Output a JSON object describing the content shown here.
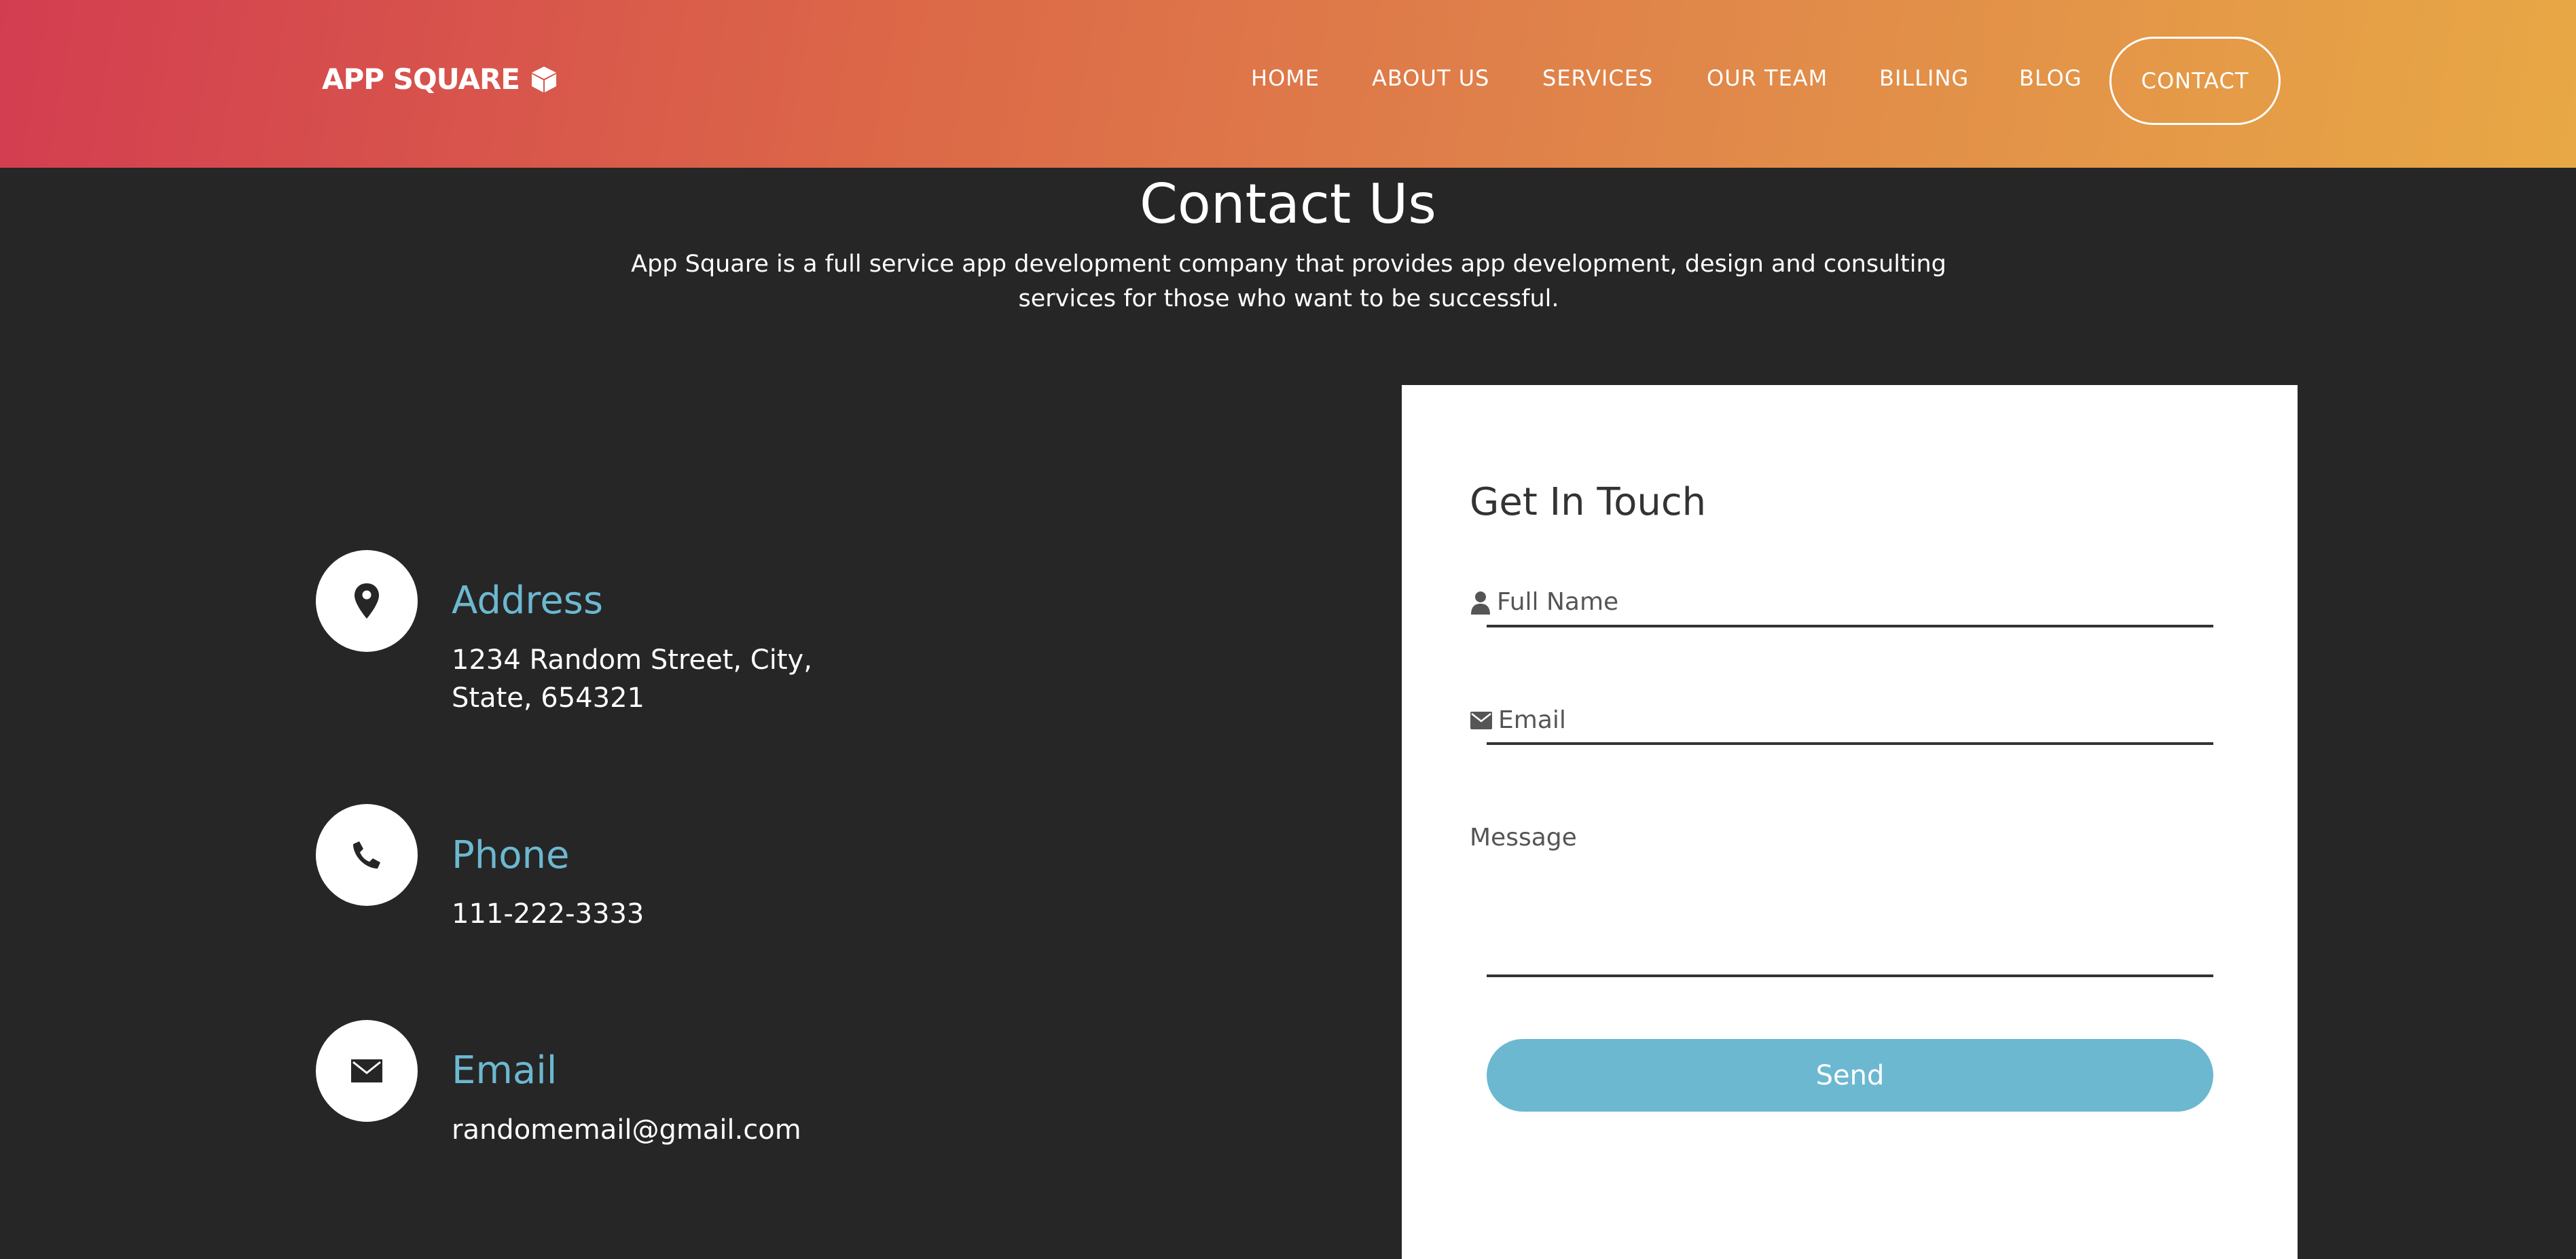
{
  "header": {
    "brand": "APP SQUARE",
    "brand_icon": "cube-icon",
    "nav": {
      "home": "HOME",
      "about": "ABOUT US",
      "services": "SERVICES",
      "team": "OUR TEAM",
      "billing": "BILLING",
      "blog": "BLOG",
      "contact": "CONTACT"
    },
    "gradient_colors": [
      "#d33d50",
      "#e8a845"
    ]
  },
  "page": {
    "title": "Contact Us",
    "description": "App Square is a full service app development company that provides app development, design and consulting services for those who want to be successful."
  },
  "info": {
    "address": {
      "icon": "map-pin-icon",
      "heading": "Address",
      "text": "1234 Random Street, City, State, 654321"
    },
    "phone": {
      "icon": "phone-icon",
      "heading": "Phone",
      "text": "111-222-3333"
    },
    "email": {
      "icon": "envelope-icon",
      "heading": "Email",
      "text": "randomemail@gmail.com"
    }
  },
  "form": {
    "title": "Get In Touch",
    "name_placeholder": "Full Name",
    "email_placeholder": "Email",
    "message_placeholder": "Message",
    "send_label": "Send"
  },
  "colors": {
    "accent": "#6cb8d0",
    "background": "#262626"
  }
}
